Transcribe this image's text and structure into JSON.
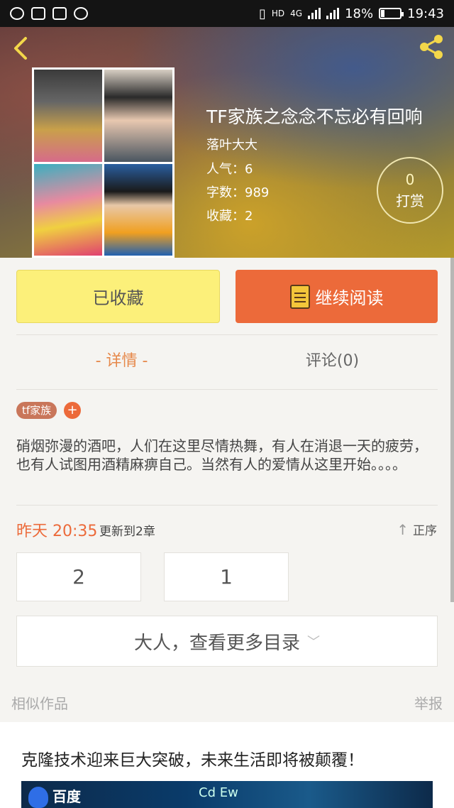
{
  "status_bar": {
    "network": "4G",
    "battery": "18%",
    "battery_level": 0.18,
    "time": "19:43"
  },
  "book": {
    "title": "TF家族之念念不忘必有回响",
    "author": "落叶大大",
    "popularity": "人气：6",
    "word_count": "字数：989",
    "favorites": "收藏：2"
  },
  "reward": {
    "count": "0",
    "label": "打赏"
  },
  "actions": {
    "collected_label": "已收藏",
    "continue_label": "继续阅读"
  },
  "tabs": {
    "details": "- 详情 -",
    "comments": "评论(0)"
  },
  "tags": {
    "tag": "tf家族",
    "add": "+"
  },
  "description": "硝烟弥漫的酒吧，人们在这里尽情热舞，有人在消退一天的疲劳，也有人试图用酒精麻痹自己。当然有人的爱情从这里开始。。。。",
  "updates": {
    "time": "昨天 20:35",
    "text": "更新到2章",
    "sort_label": "正序"
  },
  "chapters": [
    "2",
    "1"
  ],
  "more_toc_label": "大人，查看更多目录",
  "similar": {
    "heading": "相似作品",
    "report": "举报"
  },
  "ad": {
    "title": "克隆技术迎来巨大突破，未来生活即将被颠覆！",
    "brand": "百度",
    "chem_label": "Cd  Ew"
  }
}
